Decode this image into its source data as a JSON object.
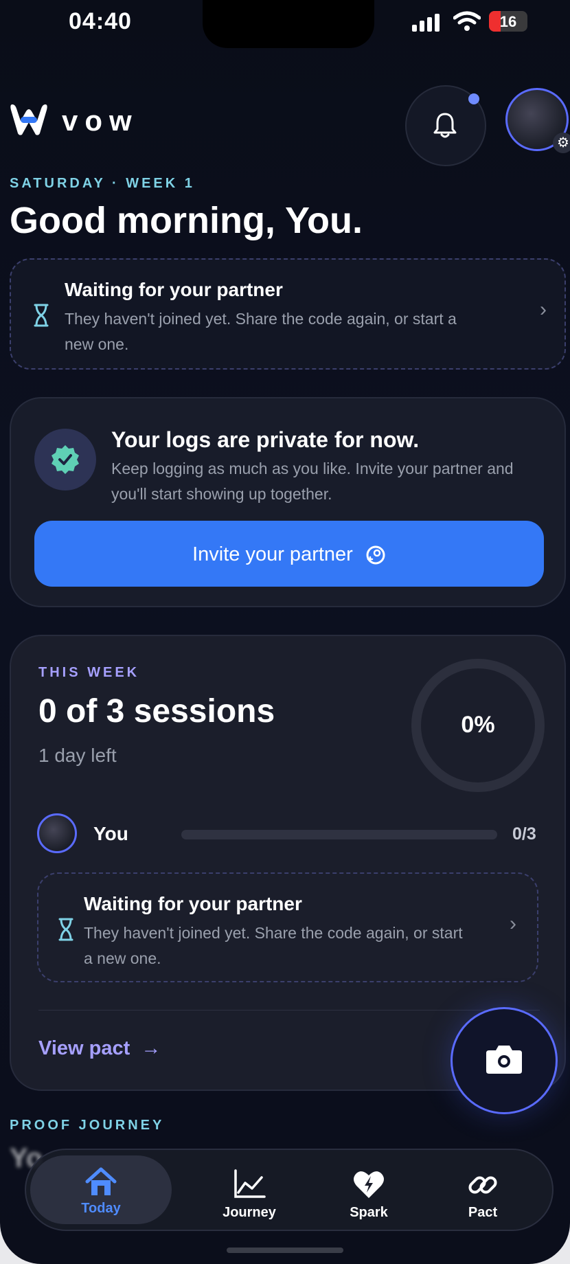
{
  "status_bar": {
    "time": "04:40",
    "battery": "16"
  },
  "header": {
    "brand": "vow"
  },
  "greeting": {
    "eyebrow": "SATURDAY · WEEK 1",
    "title": "Good morning, You."
  },
  "partner_banner": {
    "title": "Waiting for your partner",
    "subtitle": "They haven't joined yet. Share the code again, or start a new one."
  },
  "privacy_card": {
    "title": "Your logs are private for now.",
    "subtitle": "Keep logging as much as you like. Invite your partner and you'll start showing up together.",
    "button": "Invite your partner"
  },
  "week_card": {
    "eyebrow": "THIS WEEK",
    "title": "0 of 3 sessions",
    "subtitle": "1 day left",
    "progress_percent": "0%",
    "progress_fraction": 0,
    "member": {
      "name": "You",
      "count": "0/3"
    },
    "partner_notice": {
      "title": "Waiting for your partner",
      "subtitle": "They haven't joined yet. Share the code again, or start a new one."
    },
    "link": "View pact"
  },
  "proof_section": {
    "eyebrow": "PROOF JOURNEY"
  },
  "tabs": [
    {
      "label": "Today",
      "icon": "home-icon",
      "active": true
    },
    {
      "label": "Journey",
      "icon": "chart-icon",
      "active": false
    },
    {
      "label": "Spark",
      "icon": "heart-bolt-icon",
      "active": false
    },
    {
      "label": "Pact",
      "icon": "link-icon",
      "active": false
    }
  ],
  "colors": {
    "accent": "#3478f6",
    "teal": "#7fd2e6",
    "violet": "#a6a0ff",
    "ring_accent": "#5a6bff"
  }
}
